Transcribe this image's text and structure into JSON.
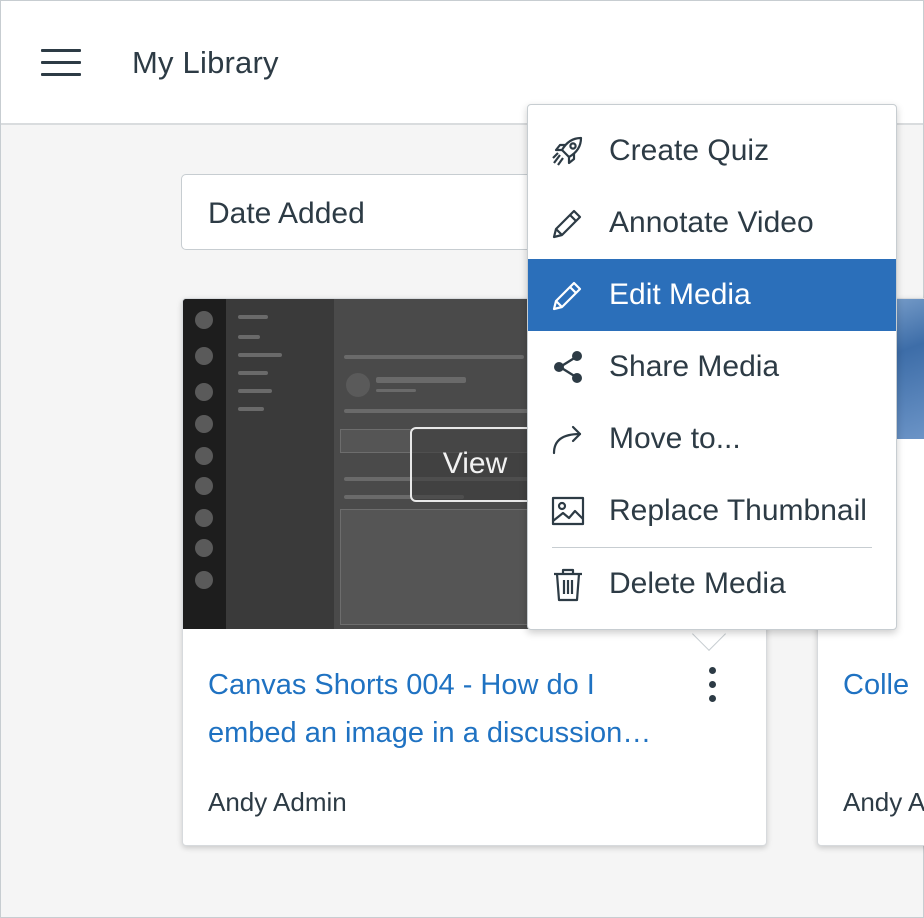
{
  "header": {
    "title": "My Library"
  },
  "sort": {
    "selected": "Date Added"
  },
  "cards": [
    {
      "title": "Canvas Shorts 004 - How do I embed an image in a discussion…",
      "author": "Andy Admin",
      "view_label": "View"
    },
    {
      "title": "Colle",
      "author": "Andy A"
    }
  ],
  "menu": {
    "items": [
      {
        "label": "Create Quiz",
        "icon": "rocket-icon"
      },
      {
        "label": "Annotate Video",
        "icon": "pencil-icon"
      },
      {
        "label": "Edit Media",
        "icon": "pencil-icon",
        "active": true
      },
      {
        "label": "Share Media",
        "icon": "share-icon"
      },
      {
        "label": "Move to...",
        "icon": "arrow-forward-icon"
      },
      {
        "label": "Replace Thumbnail",
        "icon": "image-icon"
      },
      {
        "label": "Delete Media",
        "icon": "trash-icon"
      }
    ]
  },
  "colors": {
    "link": "#1f72c2",
    "active_menu_bg": "#2b6fba",
    "text": "#2d3b45"
  }
}
